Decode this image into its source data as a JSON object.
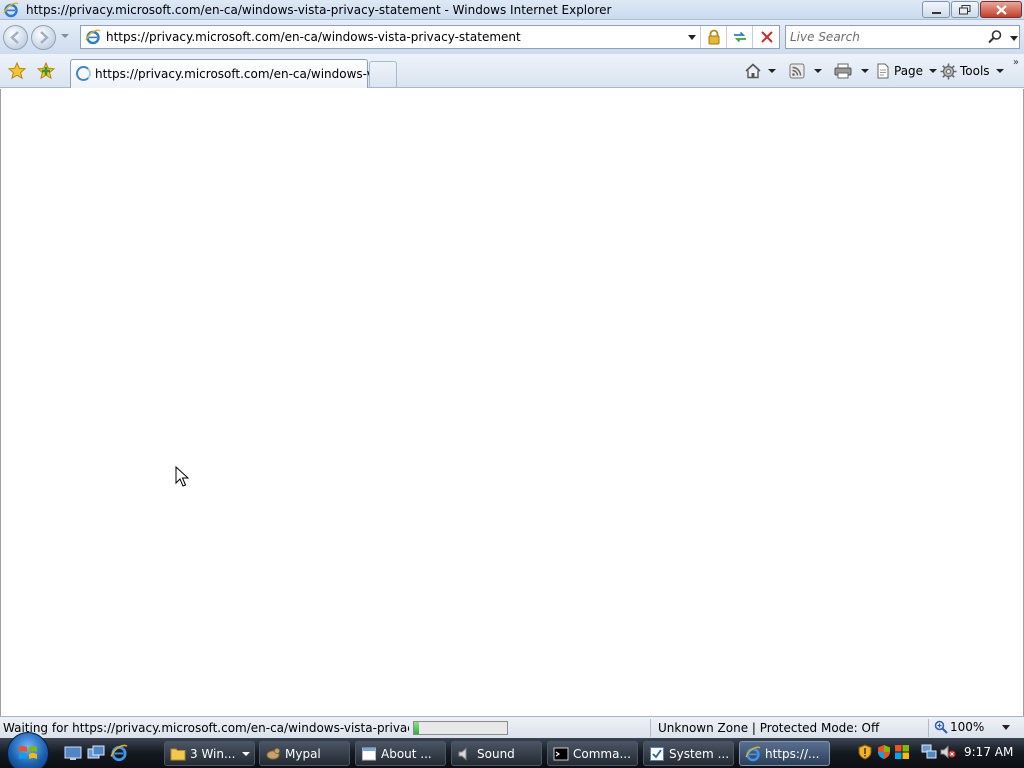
{
  "window": {
    "title": "https://privacy.microsoft.com/en-ca/windows-vista-privacy-statement - Windows Internet Explorer"
  },
  "address": {
    "url": "https://privacy.microsoft.com/en-ca/windows-vista-privacy-statement"
  },
  "search": {
    "placeholder": "Live Search"
  },
  "tabs": [
    {
      "label": "https://privacy.microsoft.com/en-ca/windows-vi...",
      "loading": true
    }
  ],
  "commands": {
    "page_label": "Page",
    "tools_label": "Tools"
  },
  "status": {
    "text": "Waiting for https://privacy.microsoft.com/en-ca/windows-vista-privacy-statement...",
    "progress": 0.05,
    "zone": "Unknown Zone | Protected Mode: Off",
    "zoom": "100%"
  },
  "taskbar": {
    "items": [
      {
        "label": "3 Win...",
        "icon": "folder-icon",
        "grouped": true
      },
      {
        "label": "Mypal",
        "icon": "mypal-icon"
      },
      {
        "label": "About ...",
        "icon": "about-window-icon"
      },
      {
        "label": "Sound",
        "icon": "speaker-icon"
      },
      {
        "label": "Comma...",
        "icon": "command-prompt-icon"
      },
      {
        "label": "System ...",
        "icon": "system-properties-icon"
      },
      {
        "label": "https://...",
        "icon": "internet-explorer-icon",
        "active": true
      }
    ],
    "clock": "9:17 AM"
  },
  "colors": {
    "progress": "#2fb12f",
    "close_button": "#c1402a",
    "taskbar": "#151a21"
  }
}
